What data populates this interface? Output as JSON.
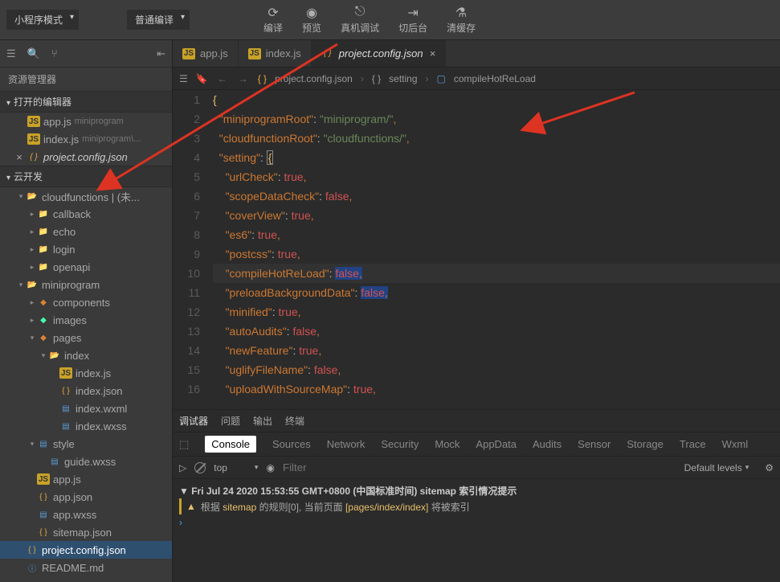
{
  "topbar": {
    "mode": "小程序模式",
    "compile": "普通编译",
    "buttons": {
      "build": "编译",
      "preview": "预览",
      "remote": "真机调试",
      "background": "切后台",
      "clear": "清缓存"
    }
  },
  "sidebar": {
    "title": "资源管理器",
    "sections": {
      "open_editors": "打开的编辑器",
      "cloud_dev": "云开发"
    },
    "open_items": [
      {
        "name": "app.js",
        "suffix": "miniprogram"
      },
      {
        "name": "index.js",
        "suffix": "miniprogram\\..."
      },
      {
        "name": "project.config.json",
        "close": true
      }
    ],
    "tree": [
      {
        "name": "cloudfunctions | (未...",
        "type": "folder-g",
        "depth": 1,
        "chev": "down"
      },
      {
        "name": "callback",
        "type": "folder",
        "depth": 2,
        "chev": "right"
      },
      {
        "name": "echo",
        "type": "folder",
        "depth": 2,
        "chev": "right"
      },
      {
        "name": "login",
        "type": "folder",
        "depth": 2,
        "chev": "right"
      },
      {
        "name": "openapi",
        "type": "folder",
        "depth": 2,
        "chev": "right"
      },
      {
        "name": "miniprogram",
        "type": "folder-o",
        "depth": 1,
        "chev": "down"
      },
      {
        "name": "components",
        "type": "orange",
        "depth": 2,
        "chev": "right"
      },
      {
        "name": "images",
        "type": "teal",
        "depth": 2,
        "chev": "right"
      },
      {
        "name": "pages",
        "type": "orange",
        "depth": 2,
        "chev": "down"
      },
      {
        "name": "index",
        "type": "folder-o",
        "depth": 3,
        "chev": "down"
      },
      {
        "name": "index.js",
        "type": "js",
        "depth": 4
      },
      {
        "name": "index.json",
        "type": "json",
        "depth": 4
      },
      {
        "name": "index.wxml",
        "type": "blue",
        "depth": 4
      },
      {
        "name": "index.wxss",
        "type": "blue",
        "depth": 4
      },
      {
        "name": "style",
        "type": "blue",
        "depth": 2,
        "chev": "down"
      },
      {
        "name": "guide.wxss",
        "type": "blue",
        "depth": 3
      },
      {
        "name": "app.js",
        "type": "js",
        "depth": 2
      },
      {
        "name": "app.json",
        "type": "json",
        "depth": 2
      },
      {
        "name": "app.wxss",
        "type": "blue",
        "depth": 2
      },
      {
        "name": "sitemap.json",
        "type": "json",
        "depth": 2
      },
      {
        "name": "project.config.json",
        "type": "json",
        "depth": 1,
        "selected": true
      },
      {
        "name": "README.md",
        "type": "md",
        "depth": 1
      }
    ]
  },
  "tabs": [
    {
      "name": "app.js",
      "icon": "js"
    },
    {
      "name": "index.js",
      "icon": "js"
    },
    {
      "name": "project.config.json",
      "icon": "json",
      "active": true
    }
  ],
  "breadcrumb": {
    "file": "project.config.json",
    "path1": "{ }",
    "path2": "setting",
    "leaf": "compileHotReLoad"
  },
  "code": {
    "lines": [
      {
        "n": 1,
        "html": "<span class='brace'>{</span>"
      },
      {
        "n": 2,
        "html": "  <span class='str'>\"miniprogramRoot\"</span>: <span class='val'>\"miniprogram/\"</span><span class='comma'>,</span>"
      },
      {
        "n": 3,
        "html": "  <span class='str'>\"cloudfunctionRoot\"</span>: <span class='val'>\"cloudfunctions/\"</span><span class='comma'>,</span>"
      },
      {
        "n": 4,
        "html": "  <span class='str'>\"setting\"</span>: <span class='brace caret-box'>{</span>"
      },
      {
        "n": 5,
        "html": "    <span class='str'>\"urlCheck\"</span>: <span class='kw-true'>true</span><span class='comma'>,</span>"
      },
      {
        "n": 6,
        "html": "    <span class='str'>\"scopeDataCheck\"</span>: <span class='kw-false'>false</span><span class='comma'>,</span>"
      },
      {
        "n": 7,
        "html": "    <span class='str'>\"coverView\"</span>: <span class='kw-true'>true</span><span class='comma'>,</span>"
      },
      {
        "n": 8,
        "html": "    <span class='str'>\"es6\"</span>: <span class='kw-true'>true</span><span class='comma'>,</span>"
      },
      {
        "n": 9,
        "html": "    <span class='str'>\"postcss\"</span>: <span class='kw-true'>true</span><span class='comma'>,</span>"
      },
      {
        "n": 10,
        "hl": true,
        "html": "    <span class='str'>\"compileHotReLoad\"</span>: <span class='kw-false sel'>false</span><span class='comma sel'>,</span>"
      },
      {
        "n": 11,
        "html": "    <span class='str'>\"preloadBackgroundData\"</span>: <span class='kw-false sel'>false</span><span class='comma sel'>,</span>"
      },
      {
        "n": 12,
        "html": "    <span class='str'>\"minified\"</span>: <span class='kw-true'>true</span><span class='comma'>,</span>"
      },
      {
        "n": 13,
        "html": "    <span class='str'>\"autoAudits\"</span>: <span class='kw-false'>false</span><span class='comma'>,</span>"
      },
      {
        "n": 14,
        "html": "    <span class='str'>\"newFeature\"</span>: <span class='kw-true'>true</span><span class='comma'>,</span>"
      },
      {
        "n": 15,
        "html": "    <span class='str'>\"uglifyFileName\"</span>: <span class='kw-false'>false</span><span class='comma'>,</span>"
      },
      {
        "n": 16,
        "html": "    <span class='str'>\"uploadWithSourceMap\"</span>: <span class='kw-true'>true</span><span class='comma'>,</span>"
      }
    ]
  },
  "debug": {
    "main_tabs": [
      "调试器",
      "问题",
      "输出",
      "终端"
    ],
    "subtabs": [
      "Console",
      "Sources",
      "Network",
      "Security",
      "Mock",
      "AppData",
      "Audits",
      "Sensor",
      "Storage",
      "Trace",
      "Wxml"
    ],
    "scope": "top",
    "filter_ph": "Filter",
    "levels": "Default levels",
    "log1_pre": "▼ Fri Jul 24 2020 15:53:55 GMT+0800 (中国标准时间) sitemap 索引情况提示",
    "log2_a": " 根据 ",
    "log2_b": "sitemap",
    "log2_c": " 的规则[0], 当前页面 ",
    "log2_d": "[pages/index/index]",
    "log2_e": " 将被索引"
  }
}
